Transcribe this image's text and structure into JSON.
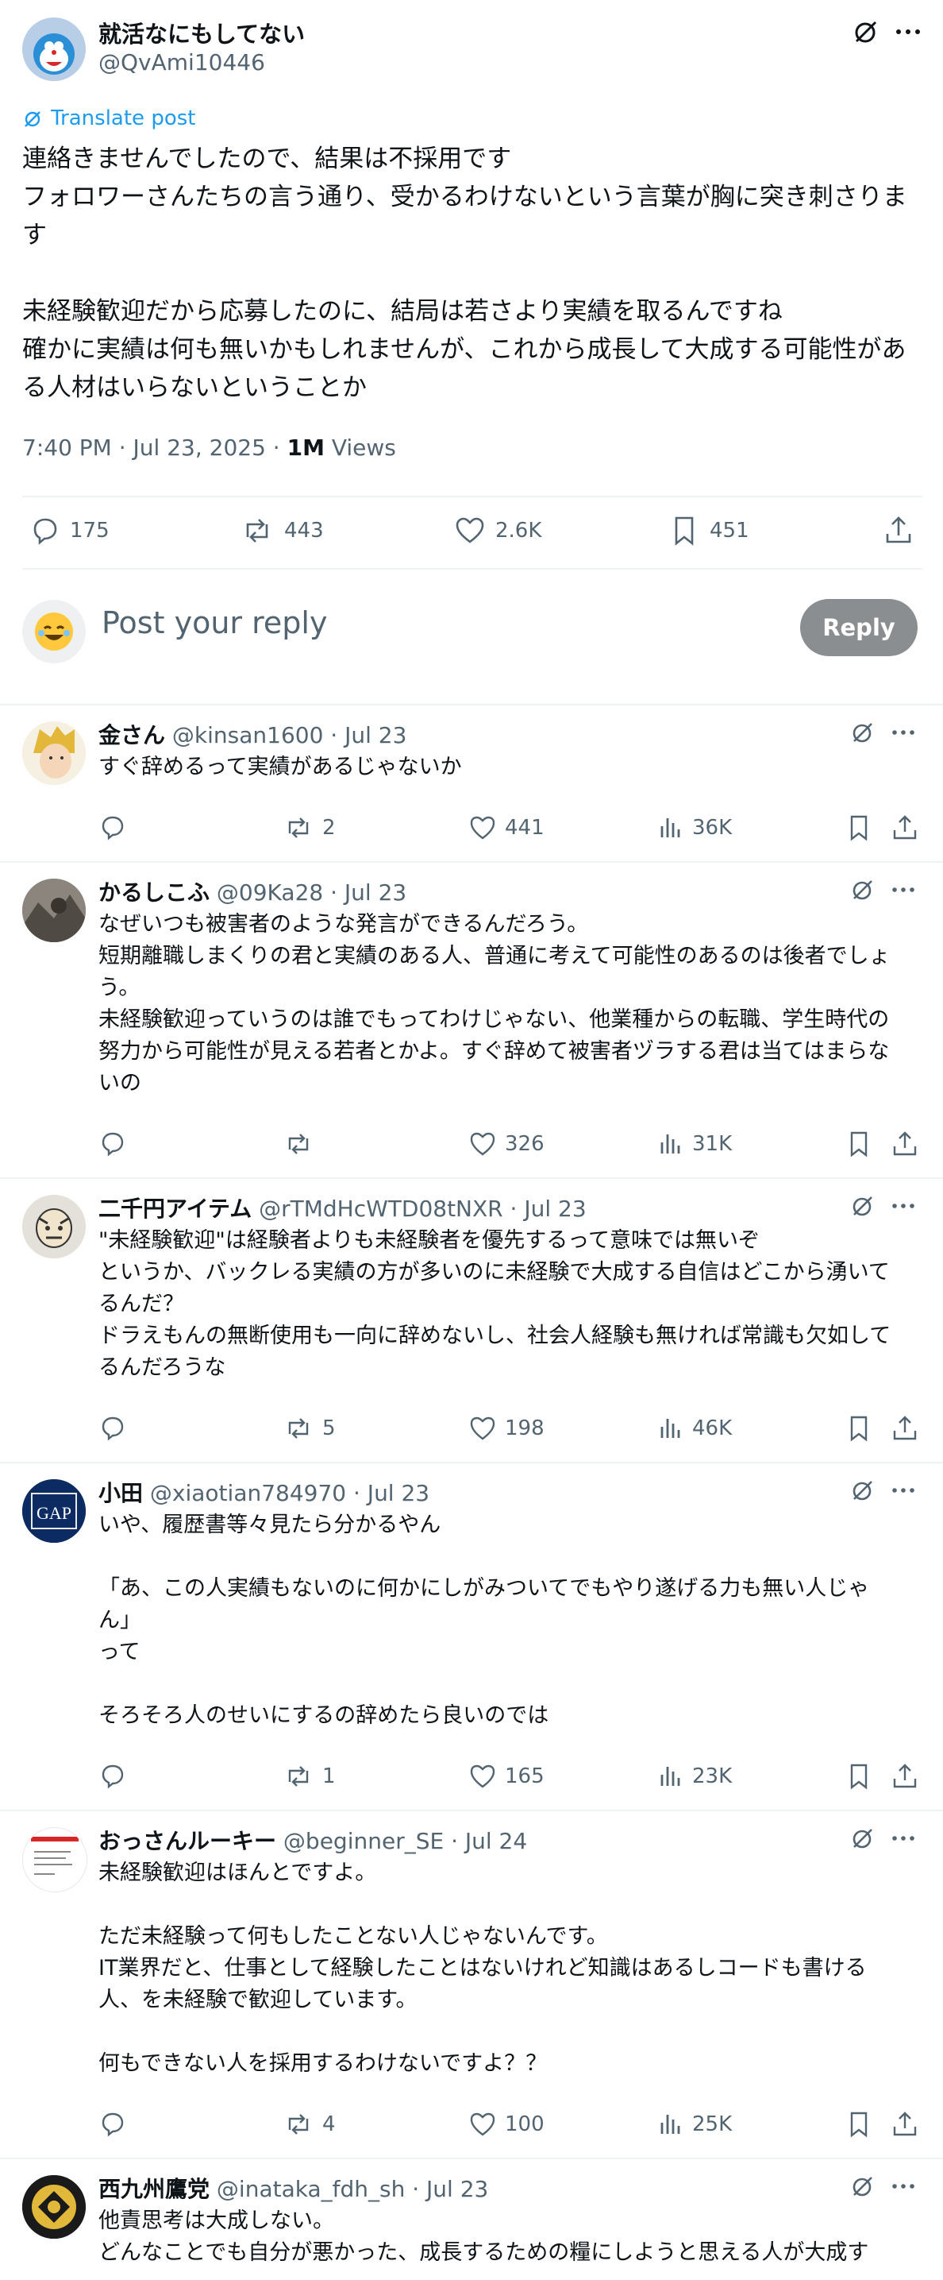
{
  "main": {
    "author_name": "就活なにもしてない",
    "author_handle": "@QvAmi10446",
    "translate_label": "Translate post",
    "text": "連絡きませんでしたので、結果は不採用です\nフォロワーさんたちの言う通り、受かるわけないという言葉が胸に突き刺さりま\nす\n\n未経験歓迎だから応募したのに、結局は若さより実績を取るんですね\n確かに実績は何も無いかもしれませんが、これから成長して大成する可能性があ\nる人材はいらないということか",
    "time": "7:40 PM · Jul 23, 2025 · ",
    "views_count": "1M",
    "views_label": " Views",
    "stats": {
      "replies": "175",
      "reposts": "443",
      "likes": "2.6K",
      "bookmarks": "451"
    }
  },
  "reply_box": {
    "placeholder": "Post your reply",
    "button_label": "Reply"
  },
  "replies": [
    {
      "name": "金さん",
      "meta": " @kinsan1600 · Jul 23",
      "text": "すぐ辞めるって実績があるじゃないか",
      "replies": "",
      "reposts": "2",
      "likes": "441",
      "views": "36K"
    },
    {
      "name": "かるしこふ",
      "meta": " @09Ka28 · Jul 23",
      "text": "なぜいつも被害者のような発言ができるんだろう。\n短期離職しまくりの君と実績のある人、普通に考えて可能性のあるのは後者でしょ\nう。\n未経験歓迎っていうのは誰でもってわけじゃない、他業種からの転職、学生時代の\n努力から可能性が見える若者とかよ。すぐ辞めて被害者ヅラする君は当てはまらな\nいの",
      "replies": "",
      "reposts": "",
      "likes": "326",
      "views": "31K"
    },
    {
      "name": "二千円アイテム",
      "meta": " @rTMdHcWTD08tNXR · Jul 23",
      "text": "\"未経験歓迎\"は経験者よりも未経験者を優先するって意味では無いぞ\nというか、バックレる実績の方が多いのに未経験で大成する自信はどこから湧いて\nるんだ？\nドラえもんの無断使用も一向に辞めないし、社会人経験も無ければ常識も欠如して\nるんだろうな",
      "replies": "",
      "reposts": "5",
      "likes": "198",
      "views": "46K"
    },
    {
      "name": "小田",
      "meta": " @xiaotian784970 · Jul 23",
      "text": "いや、履歴書等々見たら分かるやん\n\n「あ、この人実績もないのに何かにしがみついてでもやり遂げる力も無い人じゃ\nん」\nって\n\nそろそろ人のせいにするの辞めたら良いのでは",
      "replies": "",
      "reposts": "1",
      "likes": "165",
      "views": "23K"
    },
    {
      "name": "おっさんルーキー",
      "meta": " @beginner_SE · Jul 24",
      "text": "未経験歓迎はほんとですよ。\n\nただ未経験って何もしたことない人じゃないんです。\nIT業界だと、仕事として経験したことはないけれど知識はあるしコードも書ける\n人、を未経験で歓迎しています。\n\n何もできない人を採用するわけないですよ？？",
      "replies": "",
      "reposts": "4",
      "likes": "100",
      "views": "25K"
    },
    {
      "name": "西九州鷹党",
      "meta": " @inataka_fdh_sh · Jul 23",
      "text": "他責思考は大成しない。\nどんなことでも自分が悪かった、成長するための糧にしようと思える人が大成す",
      "replies": "",
      "reposts": "",
      "likes": "",
      "views": ""
    }
  ],
  "avatar_texts": {
    "gap": "GAP"
  }
}
